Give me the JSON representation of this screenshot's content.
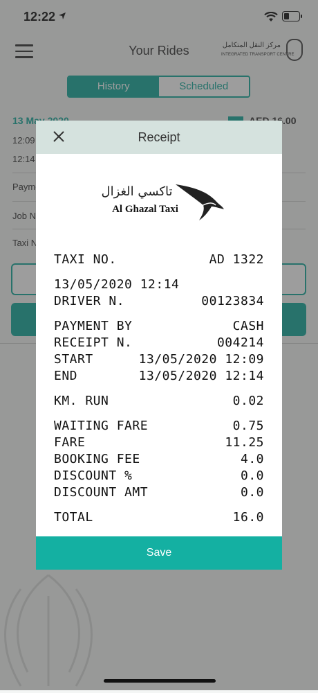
{
  "status_bar": {
    "time": "12:22"
  },
  "header": {
    "title": "Your Rides",
    "logo_ar": "مركز النقل المتكامل",
    "logo_en": "INTEGRATED TRANSPORT CENTRE"
  },
  "tabs": {
    "history": "History",
    "scheduled": "Scheduled"
  },
  "ride_card": {
    "date": "13 May 2020",
    "amount": "AED 16.00",
    "time_start": "12:09",
    "time_end": "12:14",
    "label_payment": "Payment",
    "label_job": "Job No",
    "label_taxi": "Taxi No"
  },
  "receipt_modal": {
    "title": "Receipt",
    "logo_ar": "تاكسي الغزال",
    "logo_en": "Al Ghazal Taxi",
    "lines": [
      {
        "key": "TAXI NO.",
        "value": "AD 1322"
      },
      {
        "key": "13/05/2020 12:14",
        "value": ""
      },
      {
        "key": "DRIVER N.",
        "value": "00123834"
      },
      {
        "key": "PAYMENT BY",
        "value": "CASH"
      },
      {
        "key": "RECEIPT N.",
        "value": "004214"
      },
      {
        "key": "START",
        "value": "13/05/2020 12:09"
      },
      {
        "key": "END",
        "value": "13/05/2020 12:14"
      },
      {
        "key": "KM. RUN",
        "value": "0.02"
      },
      {
        "key": "WAITING FARE",
        "value": "0.75"
      },
      {
        "key": "FARE",
        "value": "11.25"
      },
      {
        "key": "BOOKING FEE",
        "value": "4.0"
      },
      {
        "key": "DISCOUNT %",
        "value": "0.0"
      },
      {
        "key": "DISCOUNT AMT",
        "value": "0.0"
      },
      {
        "key": "TOTAL",
        "value": "16.0"
      }
    ],
    "save_label": "Save"
  },
  "colors": {
    "accent": "#14a89a",
    "save": "#14b0a2",
    "modal_header": "#d5e2de"
  }
}
